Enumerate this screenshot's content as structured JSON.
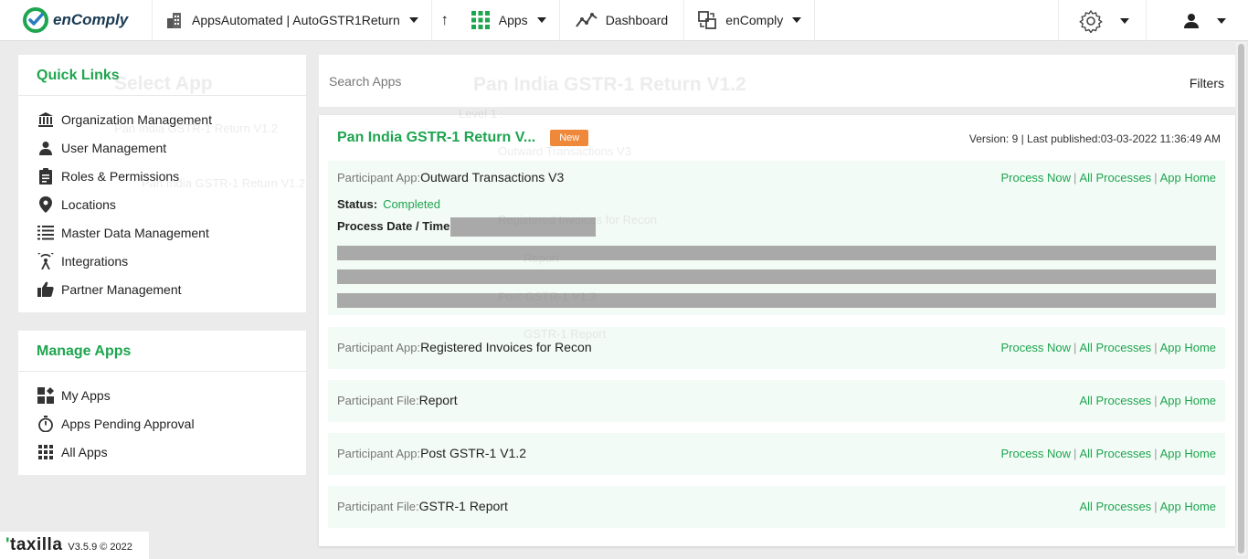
{
  "brand": {
    "name": "enComply"
  },
  "nav": {
    "workspace": "AppsAutomated | AutoGSTR1Return",
    "apps": "Apps",
    "dashboard": "Dashboard",
    "product": "enComply"
  },
  "quick_links": {
    "title": "Quick Links",
    "items": [
      {
        "label": "Organization Management",
        "icon": "bank-icon"
      },
      {
        "label": "User Management",
        "icon": "user-icon"
      },
      {
        "label": "Roles & Permissions",
        "icon": "clipboard-icon"
      },
      {
        "label": "Locations",
        "icon": "location-pin-icon"
      },
      {
        "label": "Master Data Management",
        "icon": "master-data-icon"
      },
      {
        "label": "Integrations",
        "icon": "integrations-icon"
      },
      {
        "label": "Partner Management",
        "icon": "thumbs-up-icon"
      }
    ]
  },
  "manage_apps": {
    "title": "Manage Apps",
    "items": [
      {
        "label": "My Apps",
        "icon": "my-apps-icon"
      },
      {
        "label": "Apps Pending Approval",
        "icon": "stopwatch-icon"
      },
      {
        "label": "All Apps",
        "icon": "grid-icon"
      }
    ]
  },
  "search": {
    "placeholder": "Search Apps",
    "filters": "Filters"
  },
  "app_card": {
    "title": "Pan India GSTR-1 Return V...",
    "badge": "New",
    "version": "Version: 9 | Last published:03-03-2022 11:36:49 AM",
    "rows": [
      {
        "prefix": "Participant App:",
        "name": "Outward Transactions V3",
        "process_now": "Process Now",
        "all_processes": "All Processes",
        "app_home": "App Home",
        "status_label": "Status:",
        "status_value": "Completed",
        "process_date_label": "Process Date / Time:"
      },
      {
        "prefix": "Participant App:",
        "name": "Registered Invoices for Recon",
        "process_now": "Process Now",
        "all_processes": "All Processes",
        "app_home": "App Home"
      },
      {
        "prefix": "Participant File:",
        "name": "Report",
        "all_processes": "All Processes",
        "app_home": "App Home"
      },
      {
        "prefix": "Participant App:",
        "name": "Post GSTR-1 V1.2",
        "process_now": "Process Now",
        "all_processes": "All Processes",
        "app_home": "App Home"
      },
      {
        "prefix": "Participant File:",
        "name": "GSTR-1 Report",
        "all_processes": "All Processes",
        "app_home": "App Home"
      }
    ]
  },
  "background_modal": {
    "title": "Select App",
    "app_name": "Pan India GSTR-1 Return V1.2",
    "list_item": "Pan India GSTR-1 Return V1.2",
    "heading": "Pan India GSTR-1 Return V1.2",
    "level": "Level 1 :",
    "items": [
      "Outward Transactions V3",
      "Registered Invoices for Recon",
      "Report",
      "Post GSTR-1 V1.2",
      "GSTR-1 Report"
    ]
  },
  "footer": {
    "logo": "taxilla",
    "version": "V3.5.9 © 2022"
  },
  "colors": {
    "accent": "#1ea54f",
    "badge": "#f0883a"
  }
}
